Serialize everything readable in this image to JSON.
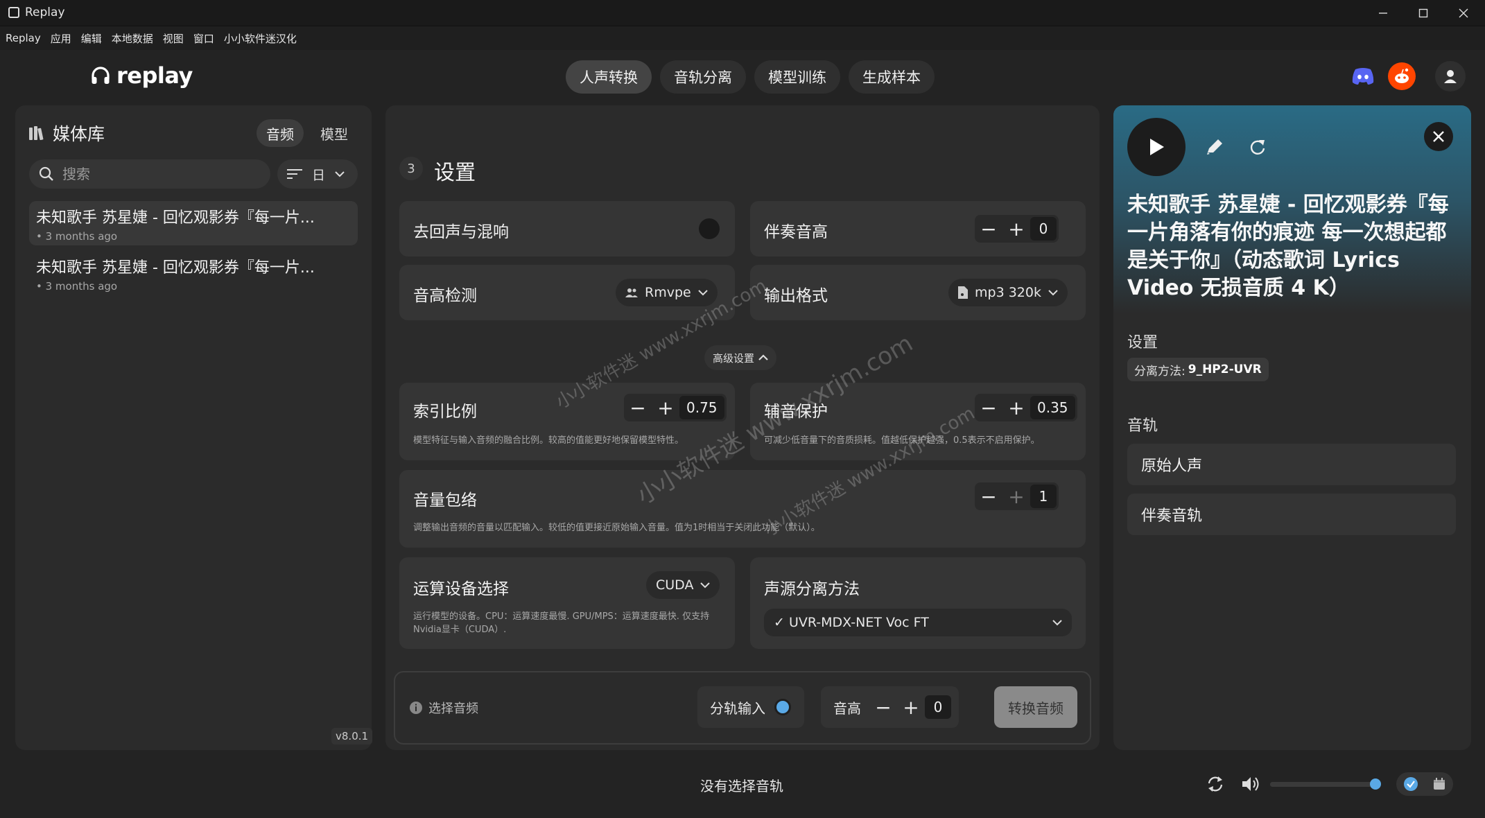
{
  "window": {
    "title": "Replay"
  },
  "menu": [
    "Replay",
    "应用",
    "编辑",
    "本地数据",
    "视图",
    "窗口",
    "小小软件迷汉化"
  ],
  "logo": {
    "text": "replay"
  },
  "nav": {
    "tabs": [
      "人声转换",
      "音轨分离",
      "模型训练",
      "生成样本"
    ],
    "active": 0
  },
  "library": {
    "title": "媒体库",
    "tabs": [
      "音频",
      "模型"
    ],
    "search_placeholder": "搜索",
    "sort_label": "日",
    "items": [
      {
        "title": "未知歌手 苏星婕 - 回忆观影券『每一片...",
        "sub": "• 3 months ago"
      },
      {
        "title": "未知歌手 苏星婕 - 回忆观影券『每一片...",
        "sub": "• 3 months ago"
      }
    ],
    "version": "v8.0.1"
  },
  "settings": {
    "step": "3",
    "title": "设置",
    "echo": {
      "label": "去回声与混响"
    },
    "accomp_pitch": {
      "label": "伴奏音高",
      "value": "0"
    },
    "pitch_detect": {
      "label": "音高检测",
      "value": "Rmvpe"
    },
    "output_format": {
      "label": "输出格式",
      "value": "mp3 320k"
    },
    "advanced": "高级设置",
    "index_ratio": {
      "label": "索引比例",
      "value": "0.75",
      "desc": "模型特征与输入音频的融合比例。较高的值能更好地保留模型特性。"
    },
    "consonant": {
      "label": "辅音保护",
      "value": "0.35",
      "desc": "可减少低音量下的音质损耗。值越低保护越强，0.5表示不启用保护。"
    },
    "volume_env": {
      "label": "音量包络",
      "value": "1",
      "desc": "调整输出音频的音量以匹配输入。较低的值更接近原始输入音量。值为1时相当于关闭此功能（默认）。"
    },
    "device": {
      "label": "运算设备选择",
      "value": "CUDA",
      "desc": "运行模型的设备。CPU：运算速度最慢. GPU/MPS：运算速度最快. 仅支持Nvidia显卡（CUDA）."
    },
    "separation": {
      "label": "声源分离方法",
      "value": "✓ UVR-MDX-NET Voc FT"
    }
  },
  "bottom": {
    "hint": "选择音频",
    "split_input": "分轨输入",
    "pitch_label": "音高",
    "pitch_value": "0",
    "convert": "转换音频"
  },
  "detail": {
    "title": "未知歌手 苏星婕 - 回忆观影券『每一片角落有你的痕迹 每一次想起都是关于你』（动态歌词 Lyrics Video 无损音质 4 K）",
    "settings_label": "设置",
    "chip_label": "分离方法:",
    "chip_value": "9_HP2-UVR",
    "tracks_label": "音轨",
    "tracks": [
      "原始人声",
      "伴奏音轨"
    ]
  },
  "player": {
    "now_playing": "没有选择音轨",
    "volume": 1.0
  },
  "watermark": [
    "小小软件迷 www.xxrjm.com",
    "小小软件迷 www.xxrjm.com",
    "小小软件迷 www.xxrjm.com"
  ],
  "colors": {
    "accent": "#5aa9e6",
    "discord": "#5865F2",
    "reddit": "#FF4500"
  }
}
